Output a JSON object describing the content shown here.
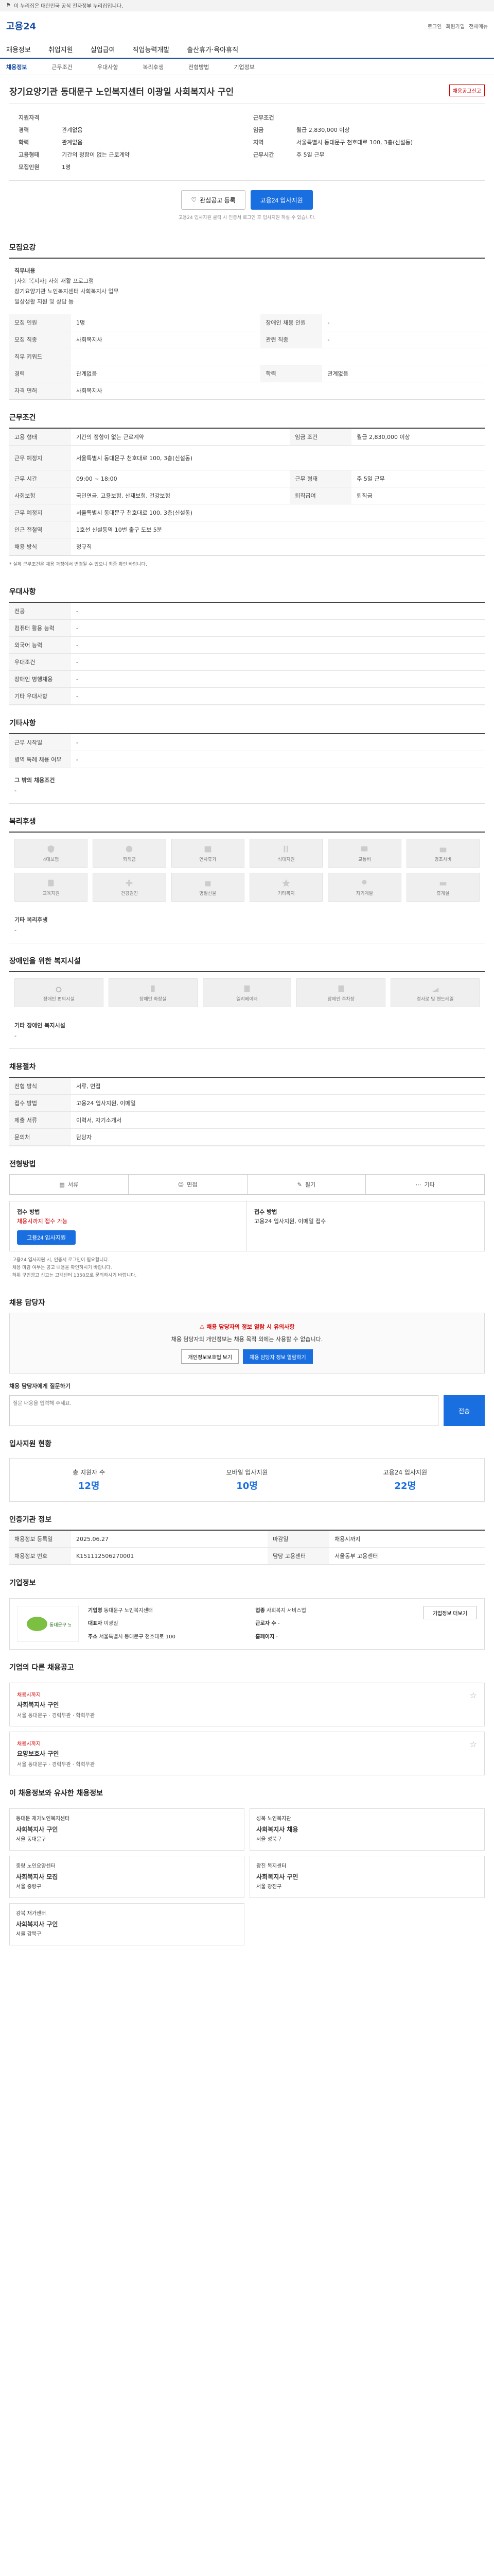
{
  "topstrip": {
    "text": "이 누리집은 대한민국 공식 전자정부 누리집입니다."
  },
  "header": {
    "logo": "고용24",
    "links": [
      "로그인",
      "회원가입",
      "전체메뉴"
    ]
  },
  "nav": [
    "채용정보",
    "취업지원",
    "실업급여",
    "직업능력개발",
    "출산휴가·육아휴직"
  ],
  "tabs": [
    "채용정보",
    "근무조건",
    "우대사항",
    "복리후생",
    "전형방법",
    "기업정보"
  ],
  "job": {
    "title": "장기요양기관 동대문구 노인복지센터 이광일 사회복지사 구인",
    "report_button": "채용공고신고"
  },
  "summary": {
    "left": [
      {
        "k": "지원자격",
        "v": ""
      },
      {
        "k": "경력",
        "v": "관계없음"
      },
      {
        "k": "학력",
        "v": "관계없음"
      },
      {
        "k": "고용형태",
        "v": "기간의 정함이 없는 근로계약"
      },
      {
        "k": "모집인원",
        "v": "1명"
      }
    ],
    "right": [
      {
        "k": "근무조건",
        "v": ""
      },
      {
        "k": "임금",
        "v": "월급 2,830,000 이상"
      },
      {
        "k": "지역",
        "v": "서울특별시 동대문구 천호대로 100, 3층(신설동)"
      },
      {
        "k": "근무시간",
        "v": "주 5일 근무"
      }
    ]
  },
  "actions": {
    "save": "관심공고 등록",
    "apply": "고용24 입사지원"
  },
  "actions_note": "고용24 입사지원 클릭 시 인증서 로그인 후 입사지원 하실 수 있습니다.",
  "recruit": {
    "heading": "모집요강",
    "duty_title": "직무내용",
    "duty_lines": [
      "[사회 복지사] 사회 재활 프로그램",
      "장기요양기관 노인복지센터 사회복지사 업무",
      "일상생활 지원 및 상담 등"
    ],
    "rows": [
      {
        "k": "모집 인원",
        "v": "1명",
        "k2": "장애인 채용 인원",
        "v2": "-"
      },
      {
        "k": "모집 직종",
        "v": "사회복지사",
        "k2": "관련 직종",
        "v2": "-"
      },
      {
        "k": "직무 키워드",
        "v": "",
        "k2": "",
        "v2": ""
      },
      {
        "k": "경력",
        "v": "관계없음",
        "k2": "학력",
        "v2": "관계없음"
      },
      {
        "k": "자격 면허",
        "v": "사회복지사",
        "k2": "",
        "v2": ""
      }
    ]
  },
  "conditions": {
    "heading": "근무조건",
    "rows": [
      {
        "k": "고용 형태",
        "v": "기간의 정함이 없는 근로계약",
        "k2": "임금 조건",
        "v2": "월급 2,830,000 이상"
      },
      {
        "k": "근무 예정지",
        "v": "서울특별시 동대문구 천호대로 100, 3층(신설동)",
        "k2": "",
        "v2": ""
      },
      {
        "k": "근무 시간",
        "v": "09:00 ~ 18:00",
        "k2": "근무 형태",
        "v2": "주 5일 근무"
      },
      {
        "k": "사회보험",
        "v": "국민연금, 고용보험, 산재보험, 건강보험",
        "k2": "퇴직급여",
        "v2": "퇴직금"
      },
      {
        "k": "근무 예정지",
        "v": "서울특별시 동대문구 천호대로 100, 3층(신설동)",
        "k2": "",
        "v2": ""
      },
      {
        "k": "인근 전철역",
        "v": "1호선 신설동역 10번 출구 도보 5분",
        "k2": "",
        "v2": ""
      },
      {
        "k": "채용 방식",
        "v": "정규직",
        "k2": "",
        "v2": ""
      }
    ],
    "note": "* 실제 근무조건은 채용 과정에서 변경될 수 있으니 최종 확인 바랍니다."
  },
  "preference": {
    "heading": "우대사항",
    "rows": [
      {
        "k": "전공",
        "v": "-"
      },
      {
        "k": "컴퓨터 활용 능력",
        "v": "-"
      },
      {
        "k": "외국어 능력",
        "v": "-"
      },
      {
        "k": "우대조건",
        "v": "-"
      },
      {
        "k": "장애인 병행채용",
        "v": "-"
      },
      {
        "k": "기타 우대사항",
        "v": "-"
      }
    ]
  },
  "other_conditions": {
    "heading": "기타사항",
    "rows": [
      {
        "k": "근무 시작일",
        "v": "-"
      },
      {
        "k": "병역 특례 채용 여부",
        "v": "-"
      }
    ],
    "extra_title": "그 밖의 채용조건",
    "extra_value": "-"
  },
  "welfare": {
    "heading": "복리후생",
    "items": [
      "4대보험",
      "퇴직금",
      "연차휴가",
      "식대지원",
      "교통비",
      "경조사비",
      "교육지원",
      "건강검진",
      "명절선물",
      "기타복지",
      "자기계발",
      "휴게실"
    ],
    "other_title": "기타 복리후생",
    "other_value": "-"
  },
  "disability": {
    "heading": "장애인을 위한 복지시설",
    "items": [
      "장애인 편의시설",
      "장애인 화장실",
      "엘리베이터",
      "장애인 주차장",
      "경사로 및 핸드레일"
    ],
    "other_title": "기타 장애인 복지시설",
    "other_value": "-"
  },
  "selection": {
    "heading": "채용절차",
    "rows": [
      {
        "k": "전형 방식",
        "v": "서류, 면접"
      },
      {
        "k": "접수 방법",
        "v": "고용24 입사지원, 이메일"
      },
      {
        "k": "제출 서류",
        "v": "이력서, 자기소개서"
      },
      {
        "k": "문의처",
        "v": "담당자"
      }
    ]
  },
  "method": {
    "heading": "전형방법",
    "items": [
      "서류",
      "면접",
      "필기",
      "기타"
    ],
    "apply_left_title": "접수 방법",
    "apply_left_text": "채용시까지 접수 가능",
    "apply_right_title": "접수 방법",
    "apply_right_text": "고용24 입사지원, 이메일 접수",
    "apply_button": "고용24 입사지원",
    "notes": [
      "· 고용24 입사지원 시, 인증서 로그인이 필요합니다.",
      "· 채용 마감 여부는 공고 내용을 확인하시기 바랍니다.",
      "· 허위 구인광고 신고는 고객센터 1350으로 문의하시기 바랍니다."
    ]
  },
  "inquiry": {
    "heading": "채용 담당자",
    "warn_title": "채용 담당자의 정보 열람 시 유의사항",
    "warn_text": "채용 담당자의 개인정보는 채용 목적 외에는 사용할 수 없습니다.",
    "buttons": [
      "개인정보보호법 보기",
      "채용 담당자 정보 열람하기"
    ],
    "ask_title": "채용 담당자에게 질문하기",
    "placeholder": "질문 내용을 입력해 주세요.",
    "send": "전송"
  },
  "stats": {
    "heading": "입사지원 현황",
    "items": [
      {
        "label": "총 지원자 수",
        "value": "12명"
      },
      {
        "label": "모바일 입사지원",
        "value": "10명"
      },
      {
        "label": "고용24 입사지원",
        "value": "22명"
      }
    ]
  },
  "registration": {
    "heading": "인증기관 정보",
    "rows": [
      {
        "k": "채용정보 등록일",
        "v": "2025.06.27",
        "k2": "마감일",
        "v2": "채용시까지"
      },
      {
        "k": "채용정보 번호",
        "v": "K151112506270001",
        "k2": "담당 고용센터",
        "v2": "서울동부 고용센터"
      }
    ]
  },
  "company": {
    "heading": "기업정보",
    "name": "동대문구 노인복지센터",
    "rows": [
      {
        "k": "기업명",
        "v": "동대문구 노인복지센터"
      },
      {
        "k": "업종",
        "v": "사회복지 서비스업"
      },
      {
        "k": "대표자",
        "v": "이광일"
      },
      {
        "k": "근로자 수",
        "v": "-"
      },
      {
        "k": "주소",
        "v": "서울특별시 동대문구 천호대로 100"
      },
      {
        "k": "홈페이지",
        "v": "-"
      }
    ],
    "more": "기업정보 더보기"
  },
  "other_jobs": {
    "heading": "기업의 다른 채용공고",
    "items": [
      {
        "status": "채용시까지",
        "title": "사회복지사 구인",
        "meta": "서울 동대문구 · 경력무관 · 학력무관"
      },
      {
        "status": "채용시까지",
        "title": "요양보호사 구인",
        "meta": "서울 동대문구 · 경력무관 · 학력무관"
      }
    ]
  },
  "similar": {
    "heading": "이 채용정보와 유사한 채용정보",
    "items": [
      {
        "company": "동대문 재가노인복지센터",
        "title": "사회복지사 구인",
        "meta": "서울 동대문구"
      },
      {
        "company": "성북 노인복지관",
        "title": "사회복지사 채용",
        "meta": "서울 성북구"
      },
      {
        "company": "중랑 노인요양센터",
        "title": "사회복지사 모집",
        "meta": "서울 중랑구"
      },
      {
        "company": "광진 복지센터",
        "title": "사회복지사 구인",
        "meta": "서울 광진구"
      },
      {
        "company": "강북 재가센터",
        "title": "사회복지사 구인",
        "meta": "서울 강북구"
      }
    ]
  }
}
